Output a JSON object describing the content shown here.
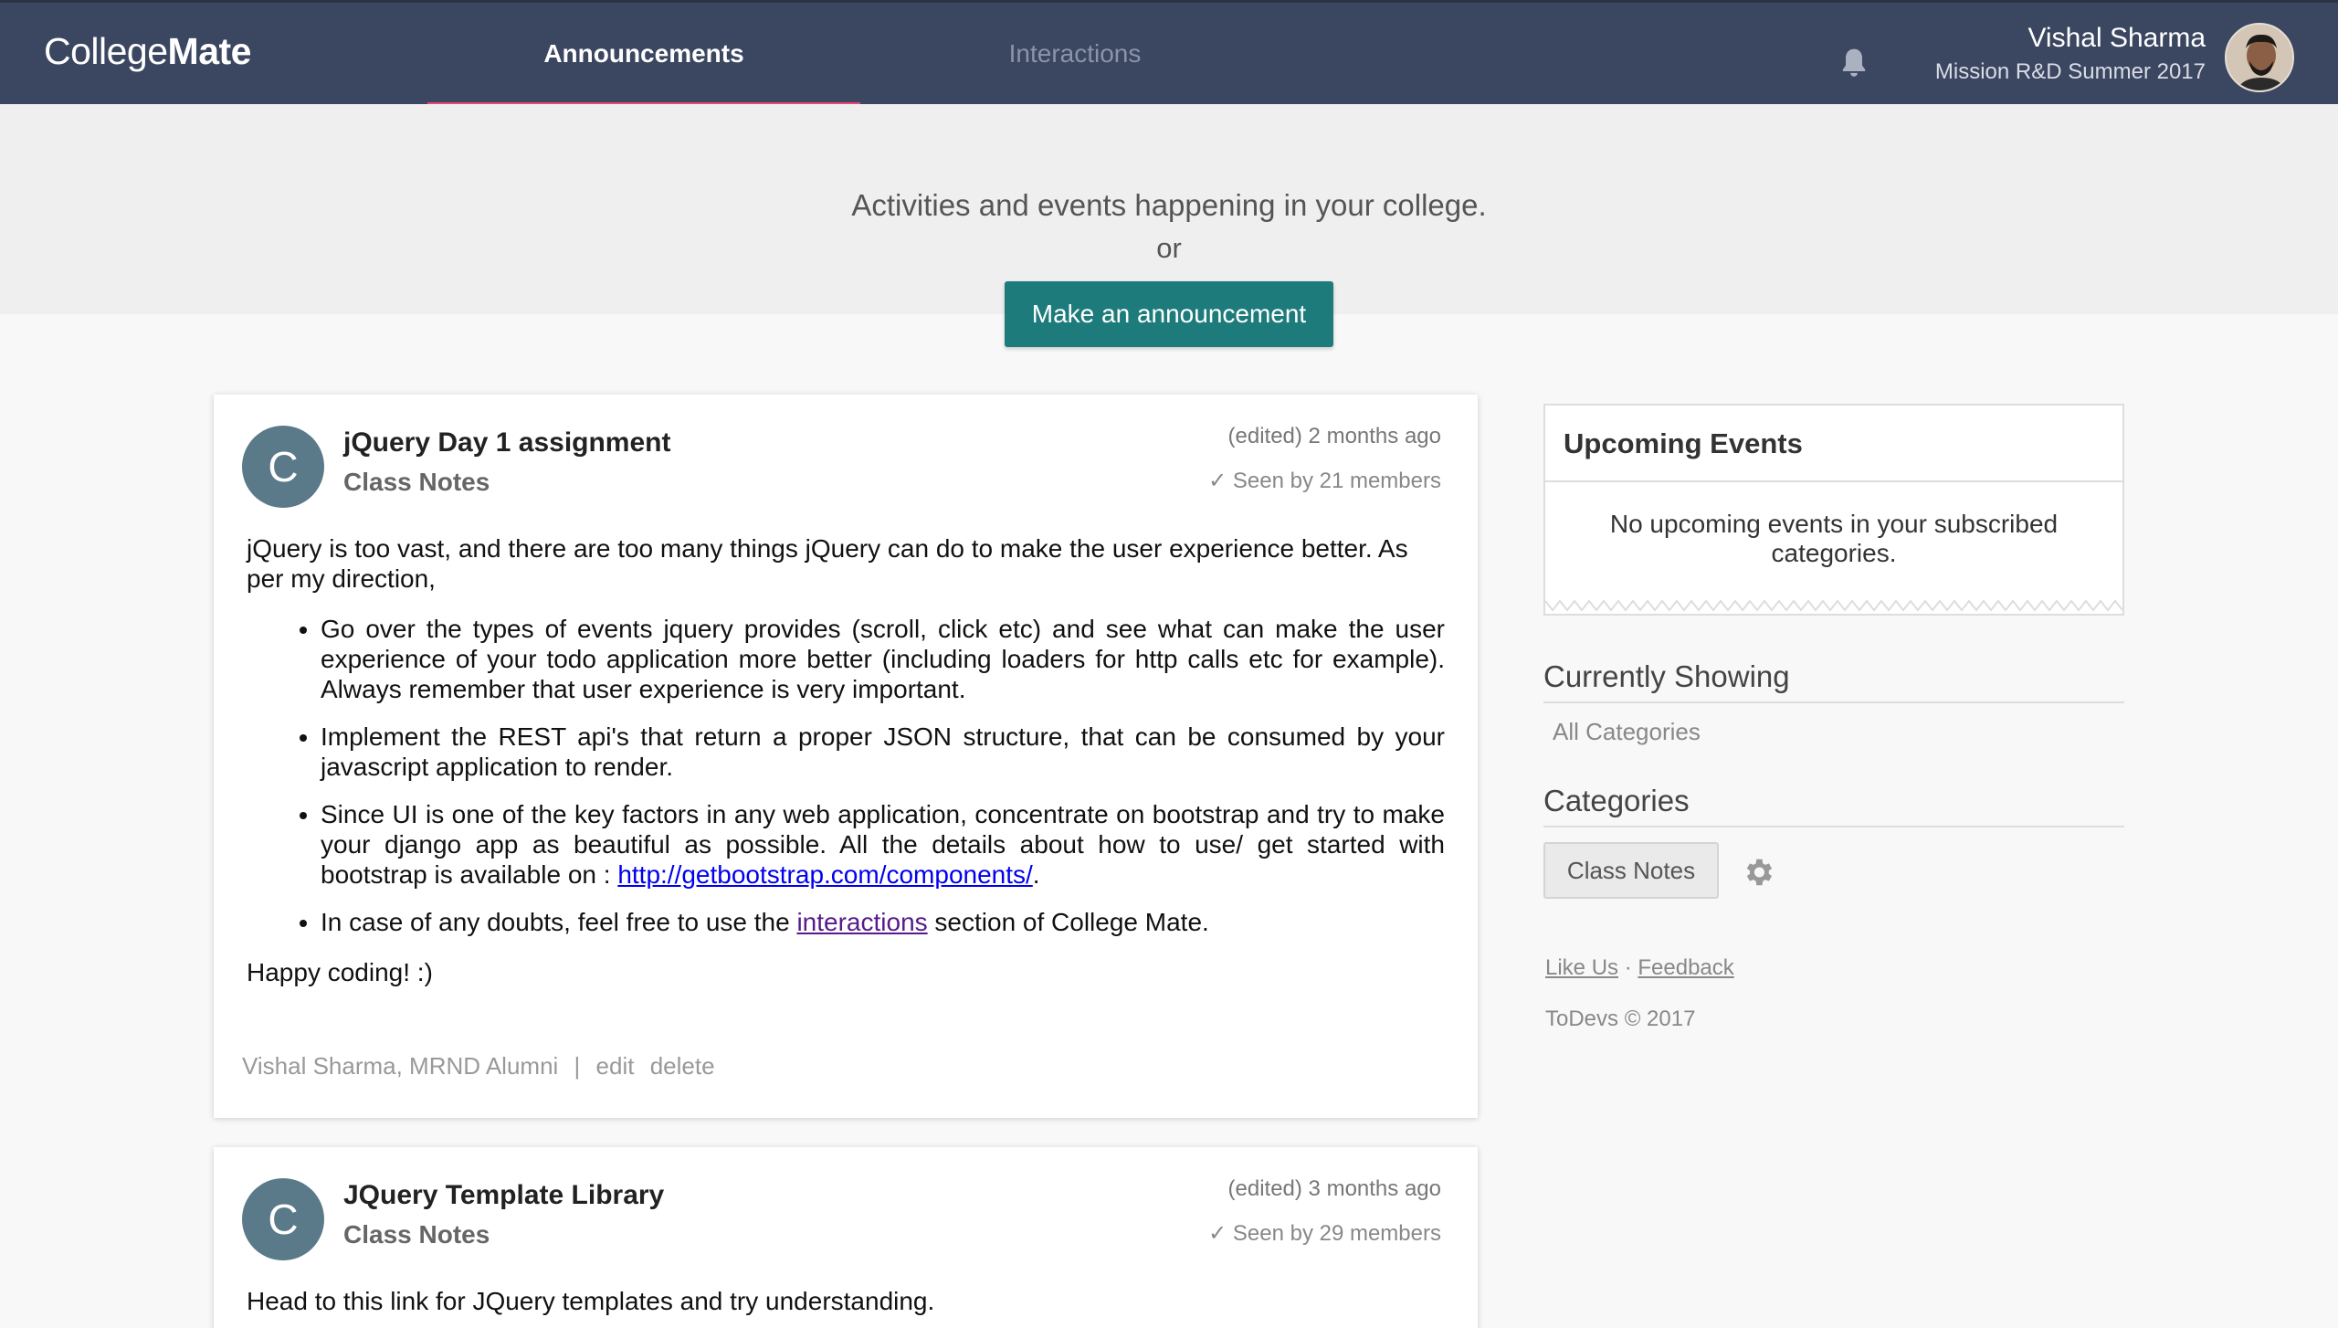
{
  "navbar": {
    "brand_light": "College",
    "brand_bold": "Mate",
    "tabs": [
      {
        "label": "Announcements",
        "active": true
      },
      {
        "label": "Interactions",
        "active": false
      }
    ],
    "user": {
      "name": "Vishal Sharma",
      "subtitle": "Mission R&D Summer 2017"
    },
    "icons": [
      "bell-icon",
      "avatar"
    ]
  },
  "hero": {
    "line1": "Activities and events happening in your college.",
    "or": "or",
    "button": "Make an announcement"
  },
  "posts": [
    {
      "avatar_letter": "C",
      "title": "jQuery Day 1 assignment",
      "category": "Class Notes",
      "time": "(edited) 2 months ago",
      "seen": "✓ Seen by 21 members",
      "intro": "jQuery is too vast, and there are too many things jQuery can do to make the user experience better. As per my direction,",
      "bullets": [
        "Go over the types of events jquery provides (scroll, click etc) and see what can make the user experience of your todo application more better (including loaders for http calls etc for example). Always remember that user experience is very important.",
        "Implement the REST api's that return a proper JSON structure, that can be consumed by your javascript application to render."
      ],
      "bullet3_text": "Since UI is one of the key factors in any web application, concentrate on bootstrap and try to make your django app as beautiful as possible. All the details about how to use/ get started with bootstrap is available on : ",
      "bullet3_link": "http://getbootstrap.com/components/",
      "bullet3_end": ".",
      "bullet4_pre": "In case of any doubts, feel free to use the ",
      "bullet4_link": "interactions",
      "bullet4_post": " section of College Mate.",
      "outro": "Happy coding! :)",
      "footer": {
        "author": "Vishal Sharma, MRND Alumni",
        "sep": "|",
        "edit": "edit",
        "delete": "delete"
      }
    },
    {
      "avatar_letter": "C",
      "title": "JQuery Template Library",
      "category": "Class Notes",
      "time": "(edited) 3 months ago",
      "seen": "✓ Seen by 29 members",
      "body": "Head to this link for JQuery templates and try understanding."
    }
  ],
  "sidebar": {
    "events_title": "Upcoming Events",
    "events_empty": "No upcoming events in your subscribed categories.",
    "showing_title": "Currently Showing",
    "showing_value": "All Categories",
    "categories_title": "Categories",
    "category_chip": "Class Notes",
    "like_us": "Like Us",
    "dot": "·",
    "feedback": "Feedback",
    "copyright": "ToDevs © 2017"
  },
  "colors": {
    "navbar": "#3b4660",
    "active_tab_underline": "#e8457a",
    "primary_button": "#1d7c7b",
    "post_avatar": "#5a7a89"
  }
}
